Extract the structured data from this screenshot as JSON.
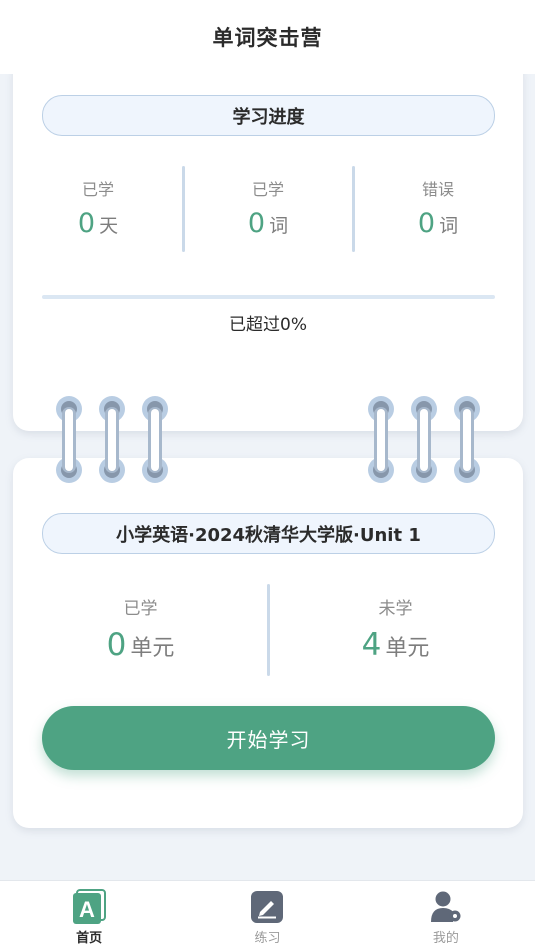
{
  "header": {
    "title": "单词突击营"
  },
  "progress_card": {
    "title": "学习进度",
    "stats": [
      {
        "label": "已学",
        "value": "0",
        "unit": "天"
      },
      {
        "label": "已学",
        "value": "0",
        "unit": "词"
      },
      {
        "label": "错误",
        "value": "0",
        "unit": "词"
      }
    ],
    "progress_percent": 0,
    "progress_text": "已超过0%"
  },
  "course_card": {
    "title": "小学英语·2024秋清华大学版·Unit 1",
    "stats": [
      {
        "label": "已学",
        "value": "0",
        "unit": "单元"
      },
      {
        "label": "未学",
        "value": "4",
        "unit": "单元"
      }
    ],
    "start_button": "开始学习"
  },
  "tabbar": {
    "items": [
      {
        "label": "首页",
        "icon": "home-letter-a-icon",
        "active": true
      },
      {
        "label": "练习",
        "icon": "practice-pen-icon",
        "active": false
      },
      {
        "label": "我的",
        "icon": "profile-settings-icon",
        "active": false
      }
    ]
  },
  "colors": {
    "accent": "#4ea383",
    "pill_bg": "#eff5fd",
    "page_bg": "#eff3f8"
  }
}
